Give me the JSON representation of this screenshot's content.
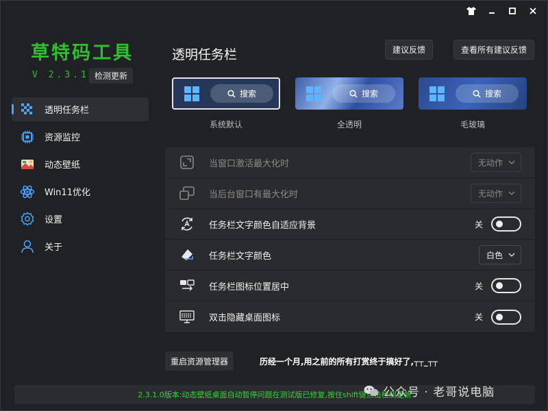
{
  "app": {
    "title": "草特码工具",
    "version": "V 2.3.1.2",
    "check_update": "检测更新"
  },
  "window_controls": [
    "shirt-icon",
    "minimize-icon",
    "maximize-icon",
    "close-icon"
  ],
  "sidebar": {
    "items": [
      {
        "label": "透明任务栏",
        "icon": "transparent-taskbar-icon",
        "active": true
      },
      {
        "label": "资源监控",
        "icon": "cpu-chip-icon",
        "active": false
      },
      {
        "label": "动态壁纸",
        "icon": "wallpaper-icon",
        "active": false
      },
      {
        "label": "Win11优化",
        "icon": "atom-icon",
        "active": false
      },
      {
        "label": "设置",
        "icon": "gear-icon",
        "active": false
      },
      {
        "label": "关于",
        "icon": "person-icon",
        "active": false
      }
    ]
  },
  "main": {
    "title": "透明任务栏",
    "feedback_button": "建议反馈",
    "view_feedback_button": "查看所有建议反馈",
    "previews": [
      {
        "label": "系统默认",
        "search": "搜索",
        "style": "default"
      },
      {
        "label": "全透明",
        "search": "搜索",
        "style": "transparent"
      },
      {
        "label": "毛玻璃",
        "search": "搜索",
        "style": "acrylic"
      }
    ],
    "settings": [
      {
        "label": "当窗口激活最大化时",
        "control": "dropdown",
        "value": "无动作",
        "disabled": true,
        "icon": "maximize-window-icon"
      },
      {
        "label": "当后台窗口有最大化时",
        "control": "dropdown",
        "value": "无动作",
        "disabled": true,
        "icon": "background-windows-icon"
      },
      {
        "label": "任务栏文字颜色自适应背景",
        "control": "toggle",
        "value": "关",
        "disabled": false,
        "icon": "auto-color-icon"
      },
      {
        "label": "任务栏文字颜色",
        "control": "dropdown",
        "value": "白色",
        "disabled": false,
        "icon": "color-fill-icon"
      },
      {
        "label": "任务栏图标位置居中",
        "control": "toggle",
        "value": "关",
        "disabled": false,
        "icon": "center-icons-icon"
      },
      {
        "label": "双击隐藏桌面图标",
        "control": "toggle",
        "value": "关",
        "disabled": false,
        "icon": "hide-desktop-icon"
      }
    ],
    "restart_button": "重启资源管理器",
    "note": "历经一个月,用之前的所有打赏终于搞好了,┬┬_┬┬"
  },
  "watermark": "公众号 · 老哥说电脑",
  "status_bar": "2.3.1.0版本:动态壁纸桌面自动暂停问题在测试版已修复,按住shift键点击检测更新",
  "colors": {
    "accent_green": "#2fbf2f",
    "status_green": "#33d633",
    "active_indicator": "#4aa3ff",
    "background": "#202124"
  }
}
